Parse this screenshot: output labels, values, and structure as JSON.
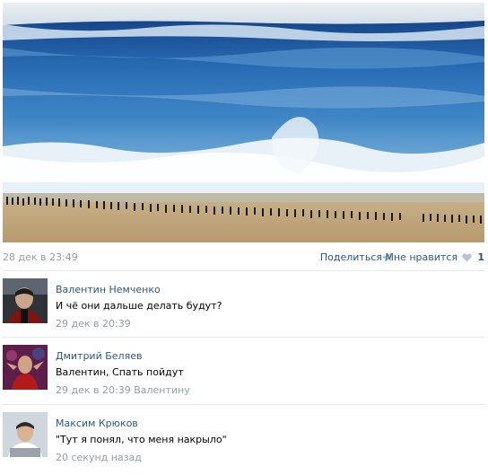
{
  "post": {
    "image_alt": "giant ocean wave crowd beach",
    "date": "28 дек в 23:49",
    "share_label": "Поделиться",
    "share_icon": "megaphone-icon",
    "like_label": "Мне нравится",
    "like_icon": "heart-icon",
    "like_count": "1"
  },
  "comments": [
    {
      "author": "Валентин Немченко",
      "text": "И чё они дальше делать будут?",
      "time": "29 дек в 20:39",
      "reply_to": ""
    },
    {
      "author": "Дмитрий Беляев",
      "text": "Валентин, Спать пойдут",
      "time": "29 дек в 20:39",
      "reply_to": "Валентину"
    },
    {
      "author": "Максим Крюков",
      "text": "\"Тут я понял, что меня накрыло\"",
      "time": "20 секунд назад",
      "reply_to": ""
    }
  ],
  "colors": {
    "link": "#2b587a",
    "muted": "#939da8",
    "separator": "#e4e8ed"
  }
}
